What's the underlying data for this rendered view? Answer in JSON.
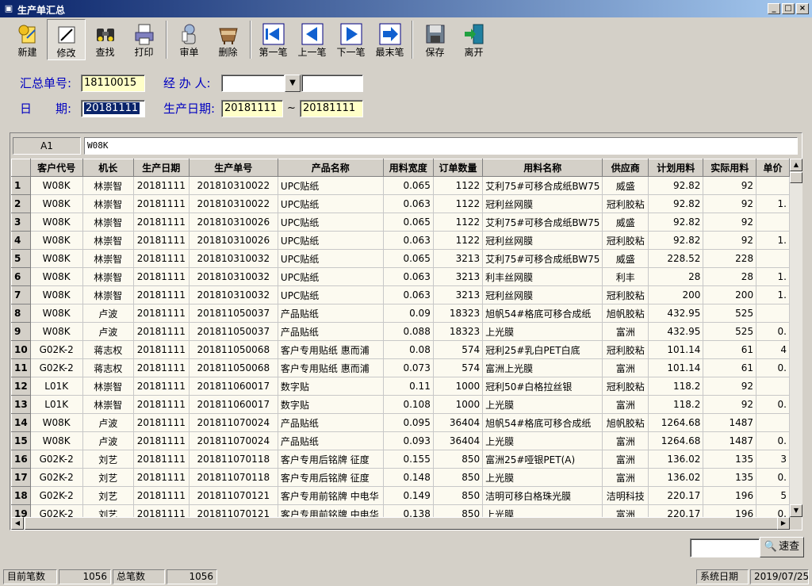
{
  "window": {
    "title": "生产单汇总",
    "min_glyph": "_",
    "max_glyph": "□",
    "close_glyph": "×"
  },
  "toolbar": {
    "new": "新建",
    "edit": "修改",
    "find": "查找",
    "print": "打印",
    "approve": "审单",
    "delete": "删除",
    "first": "第一笔",
    "prev": "上一笔",
    "next": "下一笔",
    "last": "最末笔",
    "save": "保存",
    "exit": "离开"
  },
  "form": {
    "summary_no_label": "汇总单号:",
    "summary_no": "18110015",
    "handler_label": "经 办 人:",
    "handler": "",
    "handler_name": "",
    "date_label": "日　　期:",
    "date": "20181111",
    "prod_date_label": "生产日期:",
    "prod_date_from": "20181111",
    "tilde": "~",
    "prod_date_to": "20181111"
  },
  "grid": {
    "cell_ref": "A1",
    "cell_value": "W08K",
    "columns": [
      "客户代号",
      "机长",
      "生产日期",
      "生产单号",
      "产品名称",
      "用料宽度",
      "订单数量",
      "用料名称",
      "供应商",
      "计划用料",
      "实际用料",
      "单价"
    ],
    "rows": [
      [
        "1",
        "W08K",
        "林崇智",
        "20181111",
        "201810310022",
        "UPC贴纸",
        "0.065",
        "1122",
        "艾利75#可移合成纸BW75",
        "威盛",
        "92.82",
        "92",
        ""
      ],
      [
        "2",
        "W08K",
        "林崇智",
        "20181111",
        "201810310022",
        "UPC贴纸",
        "0.063",
        "1122",
        "冠利丝网膜",
        "冠利胶粘",
        "92.82",
        "92",
        "1."
      ],
      [
        "3",
        "W08K",
        "林崇智",
        "20181111",
        "201810310026",
        "UPC贴纸",
        "0.065",
        "1122",
        "艾利75#可移合成纸BW75",
        "威盛",
        "92.82",
        "92",
        ""
      ],
      [
        "4",
        "W08K",
        "林崇智",
        "20181111",
        "201810310026",
        "UPC贴纸",
        "0.063",
        "1122",
        "冠利丝网膜",
        "冠利胶粘",
        "92.82",
        "92",
        "1."
      ],
      [
        "5",
        "W08K",
        "林崇智",
        "20181111",
        "201810310032",
        "UPC贴纸",
        "0.065",
        "3213",
        "艾利75#可移合成纸BW75",
        "威盛",
        "228.52",
        "228",
        ""
      ],
      [
        "6",
        "W08K",
        "林崇智",
        "20181111",
        "201810310032",
        "UPC贴纸",
        "0.063",
        "3213",
        "利丰丝网膜",
        "利丰",
        "28",
        "28",
        "1."
      ],
      [
        "7",
        "W08K",
        "林崇智",
        "20181111",
        "201810310032",
        "UPC贴纸",
        "0.063",
        "3213",
        "冠利丝网膜",
        "冠利胶粘",
        "200",
        "200",
        "1."
      ],
      [
        "8",
        "W08K",
        "卢波",
        "20181111",
        "201811050037",
        "产品贴纸",
        "0.09",
        "18323",
        "旭帆54#格底可移合成纸",
        "旭帆胶粘",
        "432.95",
        "525",
        ""
      ],
      [
        "9",
        "W08K",
        "卢波",
        "20181111",
        "201811050037",
        "产品贴纸",
        "0.088",
        "18323",
        "上光膜",
        "富洲",
        "432.95",
        "525",
        "0."
      ],
      [
        "10",
        "G02K-2",
        "蒋志权",
        "20181111",
        "201811050068",
        "客户专用贴纸 惠而浦",
        "0.08",
        "574",
        "冠利25#乳白PET白底",
        "冠利胶粘",
        "101.14",
        "61",
        "4"
      ],
      [
        "11",
        "G02K-2",
        "蒋志权",
        "20181111",
        "201811050068",
        "客户专用贴纸 惠而浦",
        "0.073",
        "574",
        "富洲上光膜",
        "富洲",
        "101.14",
        "61",
        "0."
      ],
      [
        "12",
        "L01K",
        "林崇智",
        "20181111",
        "201811060017",
        "数字贴",
        "0.11",
        "1000",
        "冠利50#白格拉丝银",
        "冠利胶粘",
        "118.2",
        "92",
        ""
      ],
      [
        "13",
        "L01K",
        "林崇智",
        "20181111",
        "201811060017",
        "数字贴",
        "0.108",
        "1000",
        "上光膜",
        "富洲",
        "118.2",
        "92",
        "0."
      ],
      [
        "14",
        "W08K",
        "卢波",
        "20181111",
        "201811070024",
        "产品贴纸",
        "0.095",
        "36404",
        "旭帆54#格底可移合成纸",
        "旭帆胶粘",
        "1264.68",
        "1487",
        ""
      ],
      [
        "15",
        "W08K",
        "卢波",
        "20181111",
        "201811070024",
        "产品贴纸",
        "0.093",
        "36404",
        "上光膜",
        "富洲",
        "1264.68",
        "1487",
        "0."
      ],
      [
        "16",
        "G02K-2",
        "刘艺",
        "20181111",
        "201811070118",
        "客户专用后铭牌 征度",
        "0.155",
        "850",
        "富洲25#哑银PET(A)",
        "富洲",
        "136.02",
        "135",
        "3"
      ],
      [
        "17",
        "G02K-2",
        "刘艺",
        "20181111",
        "201811070118",
        "客户专用后铭牌 征度",
        "0.148",
        "850",
        "上光膜",
        "富洲",
        "136.02",
        "135",
        "0."
      ],
      [
        "18",
        "G02K-2",
        "刘艺",
        "20181111",
        "201811070121",
        "客户专用前铭牌 中电华",
        "0.149",
        "850",
        "洁明可移白格珠光膜",
        "洁明科技",
        "220.17",
        "196",
        "5"
      ],
      [
        "19",
        "G02K-2",
        "刘艺",
        "20181111",
        "201811070121",
        "客户专用前铭牌 中电华",
        "0.138",
        "850",
        "上光膜",
        "富洲",
        "220.17",
        "196",
        "0."
      ]
    ]
  },
  "search": {
    "value": "",
    "button": "速查"
  },
  "status": {
    "current_label": "目前笔数",
    "current_value": "1056",
    "total_label": "总笔数",
    "total_value": "1056",
    "sysdate_label": "系统日期",
    "sysdate_value": "2019/07/25"
  },
  "colors": {
    "title_start": "#0a246a",
    "title_end": "#a6caf0",
    "label_blue": "#0000c0",
    "field_yellow": "#ffffc8",
    "face": "#d4d0c8"
  },
  "icons": [
    "new-icon",
    "edit-icon",
    "find-icon",
    "print-icon",
    "approve-icon",
    "delete-icon",
    "first-icon",
    "prev-icon",
    "next-icon",
    "last-icon",
    "save-icon",
    "exit-icon",
    "search-icon"
  ]
}
